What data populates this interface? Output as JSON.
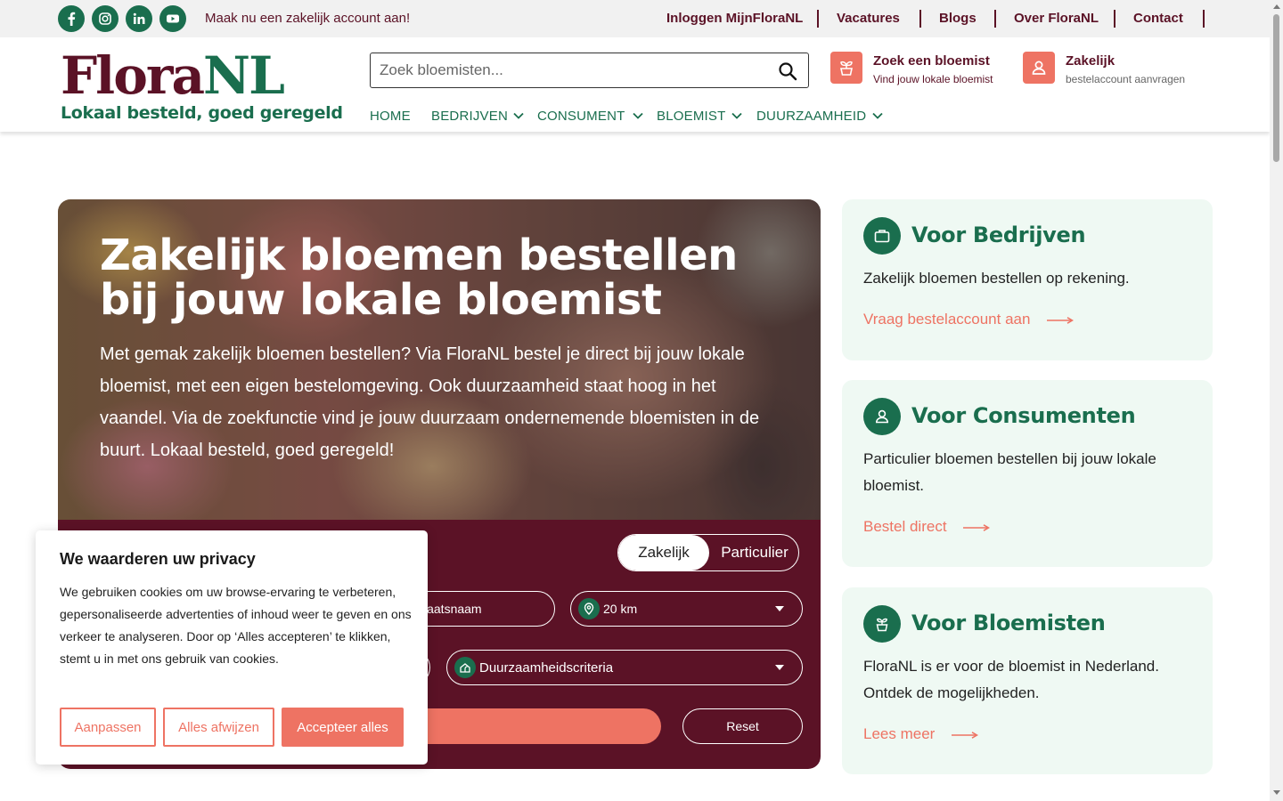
{
  "topbar": {
    "social": [
      {
        "icon": "facebook-icon"
      },
      {
        "icon": "instagram-icon"
      },
      {
        "icon": "linkedin-icon"
      },
      {
        "icon": "youtube-icon"
      }
    ],
    "promo": "Maak nu een zakelijk account aan!",
    "links": [
      "Inloggen MijnFloraNL",
      "Vacatures",
      "Blogs",
      "Over FloraNL",
      "Contact"
    ]
  },
  "header": {
    "logo_main": "Flora",
    "logo_accent": "NL",
    "logo_tagline": "Lokaal besteld, goed geregeld",
    "search_placeholder": "Zoek bloemisten...",
    "cta_florist_title": "Zoek een bloemist",
    "cta_florist_sub": "Vind jouw lokale bloemist",
    "cta_business_title": "Zakelijk",
    "cta_business_sub": "bestelaccount aanvragen",
    "nav": [
      "HOME",
      "BEDRIJVEN",
      "CONSUMENT",
      "BLOEMIST",
      "DUURZAAMHEID"
    ]
  },
  "hero": {
    "title": "Zakelijk bloemen bestellen bij jouw lokale bloemist",
    "text": "Met gemak zakelijk bloemen bestellen? Via FloraNL bestel je direct bij jouw lokale bloemist, met een eigen bestelomgeving. Ook duurzaamheid staat hoog in het vaandel. Via de zoekfunctie vind je jouw duurzaam ondernemende bloemisten in de buurt. Lokaal besteld, goed geregeld!",
    "toggle_active": "Zakelijk",
    "toggle_inactive": "Particulier",
    "place_field": "laatsnaam",
    "distance": "20 km",
    "criteria": "Duurzaamheidscriteria",
    "reset": "Reset"
  },
  "cards": [
    {
      "title": "Voor Bedrijven",
      "text": "Zakelijk bloemen bestellen op rekening.",
      "link": "Vraag bestelaccount aan",
      "icon": "briefcase-icon"
    },
    {
      "title": "Voor Consumenten",
      "text": "Particulier bloemen bestellen bij jouw lokale bloemist.",
      "link": "Bestel direct",
      "icon": "user-icon"
    },
    {
      "title": "Voor Bloemisten",
      "text": "FloraNL is er voor de bloemist in Nederland. Ontdek de mogelijkheden.",
      "link": "Lees meer",
      "icon": "plant-icon"
    }
  ],
  "cookie": {
    "title": "We waarderen uw privacy",
    "text": "We gebruiken cookies om uw browse-ervaring te verbeteren, gepersonaliseerde advertenties of inhoud weer te geven en ons verkeer te analyseren. Door op ‘Alles accepteren’ te klikken, stemt u in met ons gebruik van cookies.",
    "btn_customize": "Aanpassen",
    "btn_reject": "Alles afwijzen",
    "btn_accept": "Accepteer alles"
  },
  "colors": {
    "brand_green": "#1a6e4e",
    "brand_burgundy": "#5b1226",
    "accent_coral": "#ee7363",
    "card_bg": "#eff9f3"
  }
}
